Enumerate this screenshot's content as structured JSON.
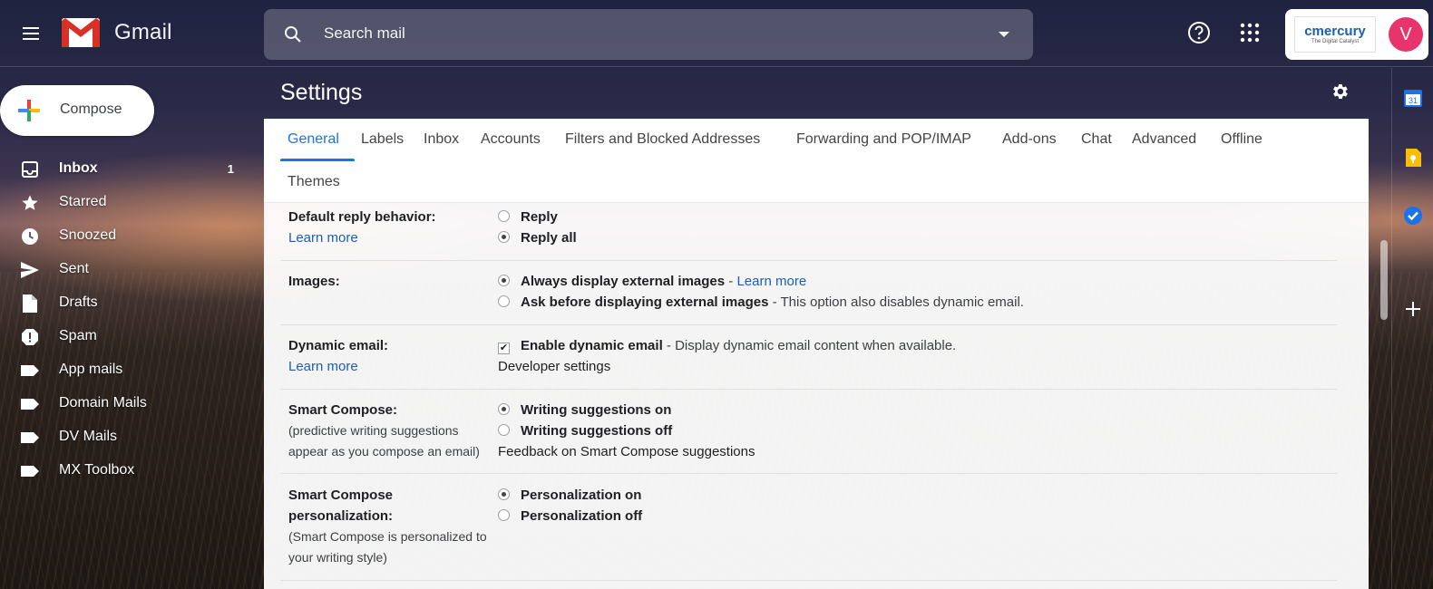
{
  "header": {
    "brand": "Gmail",
    "search_placeholder": "Search mail",
    "org_name": "cmercury",
    "org_tagline": "The Digital Catalyst",
    "avatar_letter": "V"
  },
  "compose": {
    "label": "Compose"
  },
  "sidebar": {
    "items": [
      {
        "label": "Inbox",
        "count": "1",
        "icon": "inbox-icon"
      },
      {
        "label": "Starred",
        "icon": "star-icon"
      },
      {
        "label": "Snoozed",
        "icon": "clock-icon"
      },
      {
        "label": "Sent",
        "icon": "send-icon"
      },
      {
        "label": "Drafts",
        "icon": "draft-icon"
      },
      {
        "label": "Spam",
        "icon": "spam-icon"
      },
      {
        "label": "App mails",
        "icon": "label-icon"
      },
      {
        "label": "Domain Mails",
        "icon": "label-icon"
      },
      {
        "label": "DV Mails",
        "icon": "label-icon"
      },
      {
        "label": "MX Toolbox",
        "icon": "label-icon"
      }
    ]
  },
  "settings": {
    "title": "Settings",
    "tabs": [
      "General",
      "Labels",
      "Inbox",
      "Accounts",
      "Filters and Blocked Addresses",
      "Forwarding and POP/IMAP",
      "Add-ons",
      "Chat",
      "Advanced",
      "Offline",
      "Themes"
    ],
    "active_tab": "General",
    "reply": {
      "label": "Default reply behavior:",
      "learn_more": "Learn more",
      "options": [
        "Reply",
        "Reply all"
      ],
      "selected": "Reply all"
    },
    "images": {
      "label": "Images:",
      "option1": "Always display external images",
      "option1_sep": " - ",
      "option1_link": "Learn more",
      "option2": "Ask before displaying external images",
      "option2_desc": " - This option also disables dynamic email.",
      "selected": "Always display external images"
    },
    "dynamic": {
      "label": "Dynamic email:",
      "learn_more": "Learn more",
      "checkbox_label": "Enable dynamic email",
      "checkbox_desc": " - Display dynamic email content when available.",
      "checked": true,
      "dev_link": "Developer settings"
    },
    "smart_compose": {
      "label": "Smart Compose:",
      "sub_line1": "(predictive writing suggestions",
      "sub_line2": "appear as you compose an email)",
      "options": [
        "Writing suggestions on",
        "Writing suggestions off"
      ],
      "selected": "Writing suggestions on",
      "feedback_link": "Feedback on Smart Compose suggestions"
    },
    "personalization": {
      "label_line1": "Smart Compose",
      "label_line2": "personalization:",
      "sub_line1": "(Smart Compose is personalized to",
      "sub_line2": "your writing style)",
      "options": [
        "Personalization on",
        "Personalization off"
      ],
      "selected": "Personalization on"
    }
  },
  "side_panel": {
    "calendar_day": "31",
    "icons": [
      "calendar-icon",
      "keep-icon",
      "tasks-icon",
      "add-icon"
    ]
  },
  "colors": {
    "link": "#1a5fb4",
    "active_tab": "#1a73e8",
    "avatar": "#e8336d"
  }
}
